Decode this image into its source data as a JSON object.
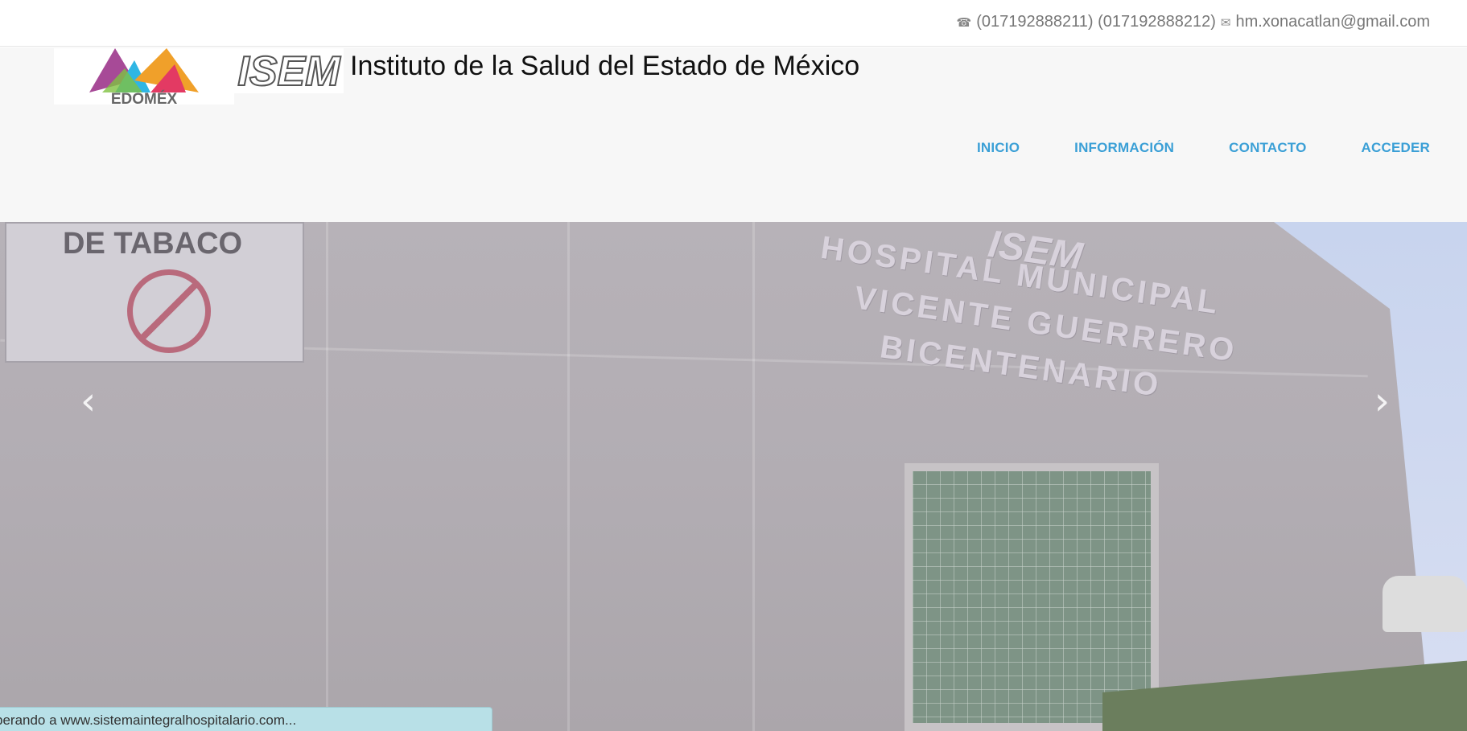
{
  "topbar": {
    "phone_icon": "phone-icon",
    "phones": "(017192888211) (017192888212)",
    "mail_icon": "envelope-icon",
    "email": "hm.xonacatlan@gmail.com"
  },
  "header": {
    "logo_edomex_text": "EDOMÉX",
    "logo_isem_text": "ISEM",
    "title": "Instituto de la Salud del Estado de México"
  },
  "nav": {
    "items": [
      {
        "label": "INICIO"
      },
      {
        "label": "INFORMACIÓN"
      },
      {
        "label": "CONTACTO"
      },
      {
        "label": "ACCEDER"
      }
    ],
    "color": "#3a9fd6"
  },
  "hero": {
    "sign_text": "DE TABACO",
    "hospital_lines": [
      "HOSPITAL MUNICIPAL",
      "VICENTE GUERRERO",
      "BICENTENARIO"
    ],
    "building_logo": "ISEM",
    "prev_icon": "chevron-left-icon",
    "next_icon": "chevron-right-icon"
  },
  "statusbar": {
    "text": "perando a www.sistemaintegralhospitalario.com..."
  }
}
